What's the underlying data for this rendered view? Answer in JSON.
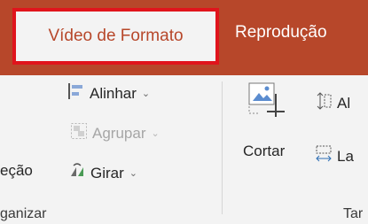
{
  "tabs": {
    "active_label": "Vídeo de Formato",
    "next_label": "Reprodução"
  },
  "arrange": {
    "align_label": "Alinhar",
    "group_label": "Agrupar",
    "rotate_label": "Girar",
    "left_clip_label": "eção",
    "group_caption": "ganizar"
  },
  "size": {
    "crop_label": "Cortar",
    "height_clip": "Al",
    "width_clip": "La",
    "group_caption": "Tar"
  },
  "colors": {
    "tab_bar": "#b7472a",
    "highlight_border": "#e0141c",
    "ribbon_bg": "#f3f3f3"
  },
  "icons": [
    "align-icon",
    "group-icon",
    "rotate-icon",
    "crop-icon",
    "height-icon",
    "width-icon",
    "chevron-down-icon"
  ]
}
